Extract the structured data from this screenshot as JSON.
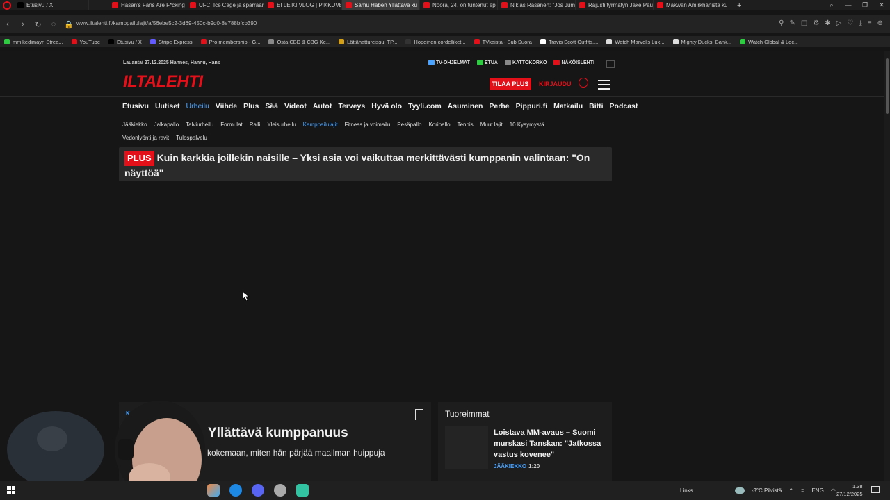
{
  "browser": {
    "tabs": [
      {
        "label": "Etusivu / X",
        "color": "#000000"
      },
      {
        "label": "Hasan's Fans Are F*cking",
        "color": "#e3101a"
      },
      {
        "label": "UFC, Ice Cage ja sparraami",
        "color": "#e3101a"
      },
      {
        "label": "EI LEIKI VLOG | PIKKUVELI",
        "color": "#e3101a"
      },
      {
        "label": "Samu Haben Yllättävä ku",
        "color": "#e3101a",
        "active": true
      },
      {
        "label": "Noora, 24, on tuntenut ep",
        "color": "#e3101a"
      },
      {
        "label": "Niklas Räsänen: \"Jos Jum",
        "color": "#e3101a"
      },
      {
        "label": "Rajusti tyrmätyn Jake Paul",
        "color": "#e3101a"
      },
      {
        "label": "Makwan Amirkhanista ku",
        "color": "#e3101a"
      }
    ],
    "url": "www.iltalehti.fi/kamppailulajit/a/56ebe5c2-3d69-450c-b9d0-8e788bfcb390",
    "bookmarks": [
      {
        "label": "mmikedimayn Strea...",
        "color": "#2ecc40"
      },
      {
        "label": "YouTube",
        "color": "#e3101a"
      },
      {
        "label": "Etusivu / X",
        "color": "#000000"
      },
      {
        "label": "Stripe Express",
        "color": "#635bff"
      },
      {
        "label": "Pro membership - G...",
        "color": "#e3101a"
      },
      {
        "label": "Osta CBD & CBG Ke...",
        "color": "#888888"
      },
      {
        "label": "Lättähattureissu: TP...",
        "color": "#d4a017"
      },
      {
        "label": "Hopeinen cordelliket...",
        "color": "#333333"
      },
      {
        "label": "TVkaista - Sub Suora",
        "color": "#e3101a"
      },
      {
        "label": "Travis Scott Outfits,...",
        "color": "#ffffff"
      },
      {
        "label": "Watch Marvel's Luk...",
        "color": "#dddddd"
      },
      {
        "label": "Mighty Ducks: Bank...",
        "color": "#dddddd"
      },
      {
        "label": "Watch Global & Loc...",
        "color": "#2ecc40"
      }
    ]
  },
  "site": {
    "date": "Lauantai 27.12.2025  Hannes, Hannu, Hans",
    "util": [
      {
        "label": "TV-OHJELMAT",
        "icon": "tv-icon",
        "color": "#4aa3ff"
      },
      {
        "label": "ETUA",
        "icon": "tag-icon",
        "color": "#2ecc40"
      },
      {
        "label": "KATTOKORKO",
        "icon": "k-icon",
        "color": "#888888"
      },
      {
        "label": "NÄKÖISLEHTI",
        "icon": "newspaper-icon",
        "color": "#e3101a"
      }
    ],
    "logo": "ILTALEHTI",
    "tilaa_plus": "TILAA PLUS",
    "kirjaudu": "KIRJAUDU",
    "main_nav": [
      "Etusivu",
      "Uutiset",
      "Urheilu",
      "Viihde",
      "Plus",
      "Sää",
      "Videot",
      "Autot",
      "Terveys",
      "Hyvä olo",
      "Tyyli.com",
      "Asuminen",
      "Perhe",
      "Pippuri.fi",
      "Matkailu",
      "Bitti",
      "Podcast"
    ],
    "main_nav_selected": "Urheilu",
    "sub_nav": [
      "Jääkiekko",
      "Jalkapallo",
      "Talviurheilu",
      "Formulat",
      "Ralli",
      "Yleisurheilu",
      "Kamppailulajit",
      "Fitness ja voimailu",
      "Pesäpallo",
      "Koripallo",
      "Tennis",
      "Muut lajit",
      "10 Kysymystä",
      "Vedonlyönti ja ravit",
      "Tulospalvelu"
    ],
    "sub_nav_selected": "Kamppailulajit",
    "plus_banner": {
      "badge": "PLUS",
      "title": "Kuin karkkia joillekin naisille – Yksi asia voi vaikuttaa merkittävästi kumppanin valintaan: \"On näyttöä\""
    },
    "article": {
      "category": "K",
      "title": "Yllättävä kumppanuus",
      "subtitle": "kokemaan, miten hän pärjää maailman huippuja"
    },
    "latest": {
      "heading": "Tuoreimmat",
      "item_title": "Loistava MM-avaus – Suomi murskasi Tanskan: \"Jatkossa vastus kovenee\"",
      "item_category": "JÄÄKIEKKO",
      "item_time": "1:20"
    }
  },
  "taskbar": {
    "links": "Links",
    "weather": "-3°C  Pilvistä",
    "lang": "ENG",
    "time": "1.38",
    "date": "27/12/2025"
  }
}
